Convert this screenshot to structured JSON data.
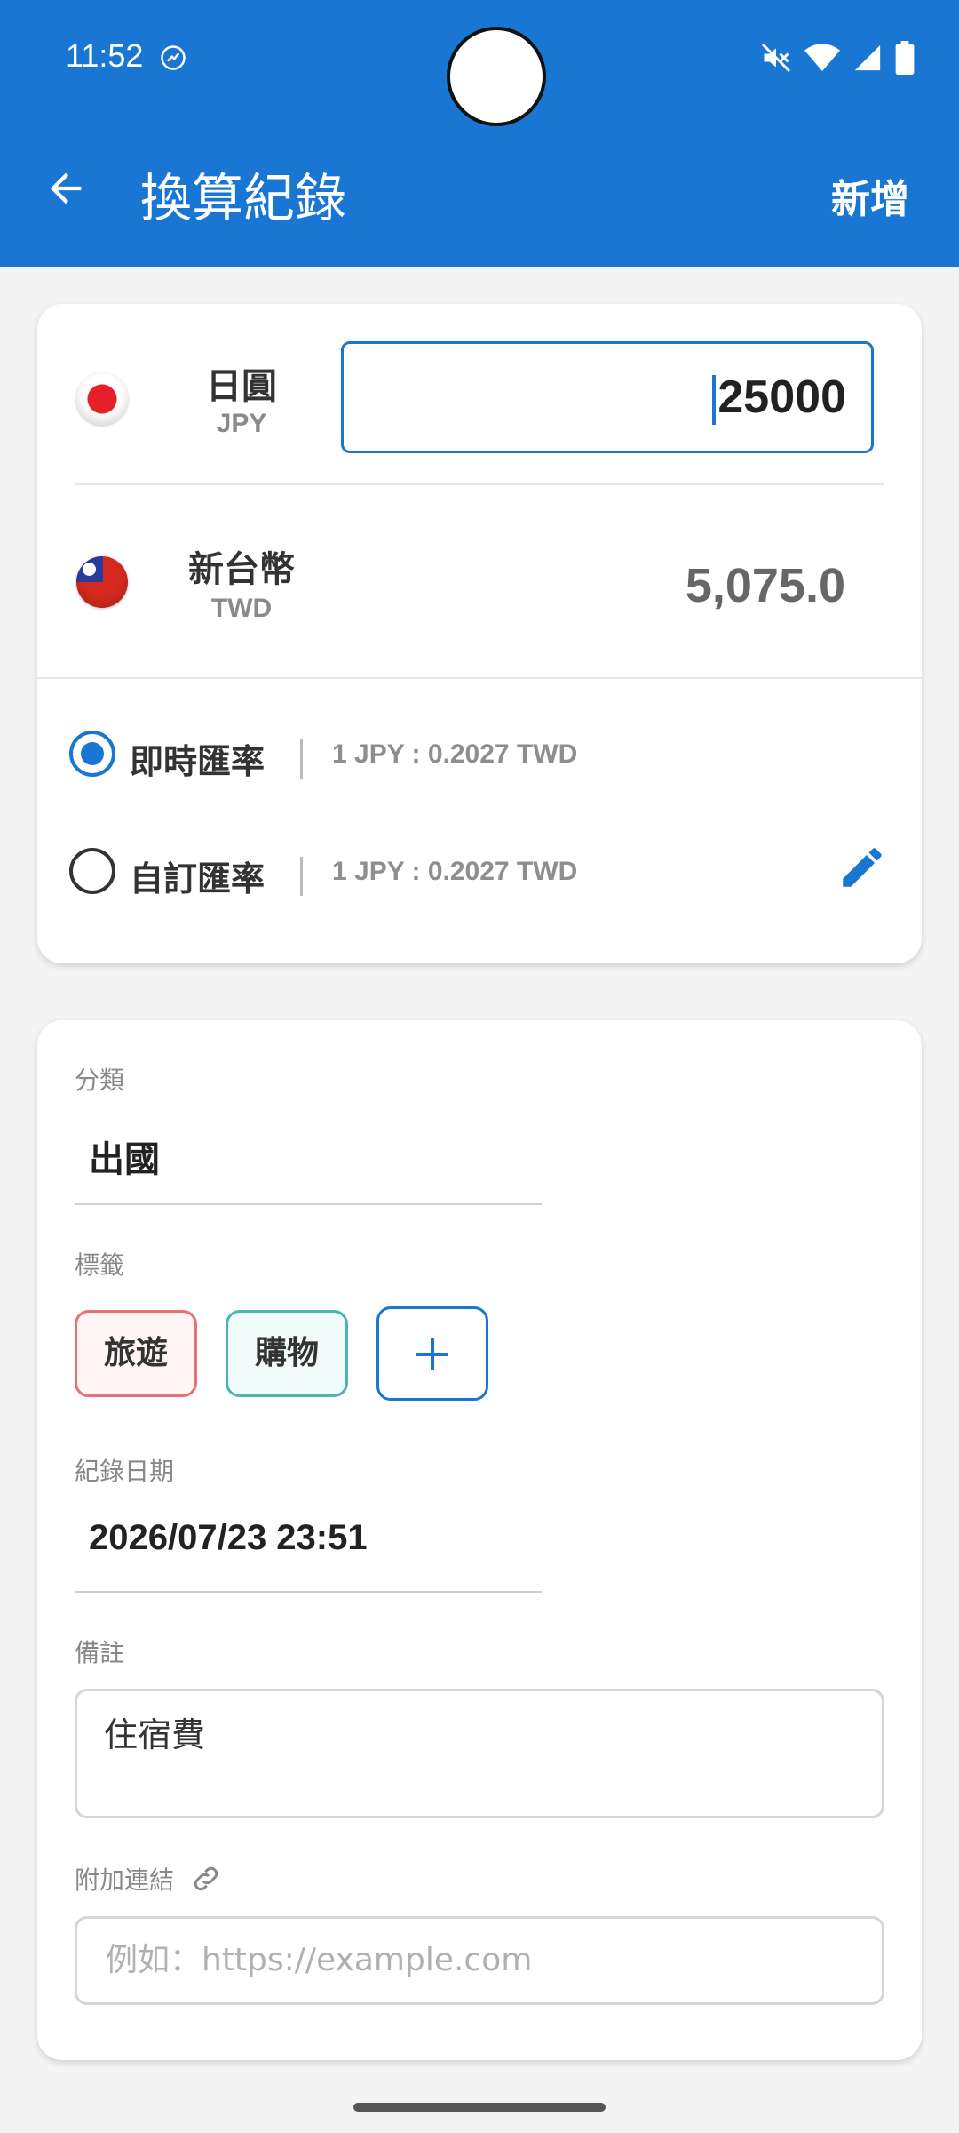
{
  "status_bar": {
    "time": "11:52"
  },
  "toolbar": {
    "title": "換算紀錄",
    "action": "新增"
  },
  "converter": {
    "from": {
      "name": "日圓",
      "code": "JPY",
      "amount": "25000"
    },
    "to": {
      "name": "新台幣",
      "code": "TWD",
      "amount": "5,075.0"
    },
    "rates": [
      {
        "label": "即時匯率",
        "value": "1 JPY : 0.2027 TWD",
        "selected": true
      },
      {
        "label": "自訂匯率",
        "value": "1 JPY : 0.2027 TWD",
        "selected": false
      }
    ]
  },
  "details": {
    "category_label": "分類",
    "category_value": "出國",
    "tags_label": "標籤",
    "tags": [
      "旅遊",
      "購物"
    ],
    "date_label": "紀錄日期",
    "date_value": "2026/07/23 23:51",
    "note_label": "備註",
    "note_value": "住宿費",
    "link_label": "附加連結",
    "link_placeholder": "例如：https://example.com"
  },
  "colors": {
    "primary": "#1976d2",
    "tag_red": "#e57373",
    "tag_teal": "#4db6ac"
  }
}
